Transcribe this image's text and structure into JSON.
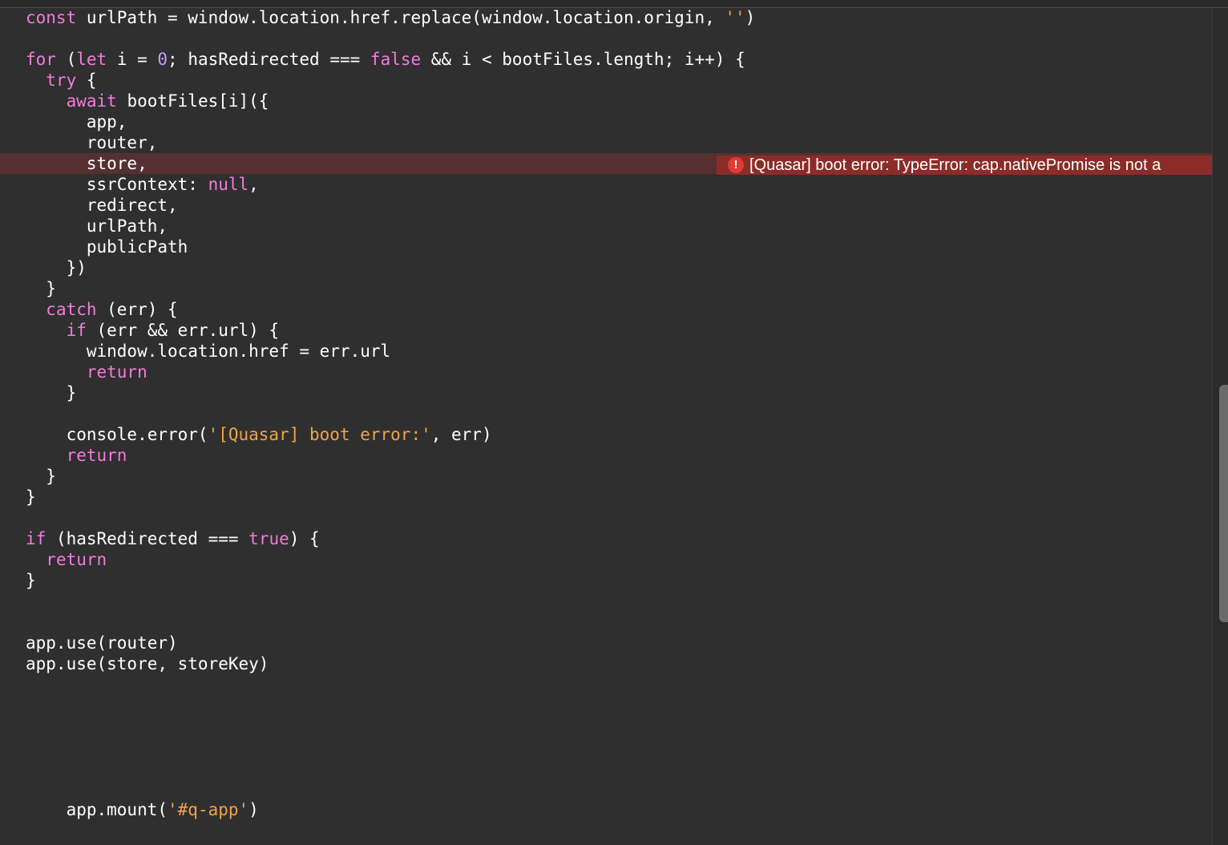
{
  "code_lines": [
    {
      "line": 1,
      "tokens": [
        {
          "t": "kw",
          "v": "const"
        },
        {
          "t": "plain",
          "v": " urlPath = window.location.href.replace(window.location.origin, "
        },
        {
          "t": "str",
          "v": "''"
        },
        {
          "t": "plain",
          "v": ")"
        }
      ]
    },
    {
      "line": 3,
      "tokens": [
        {
          "t": "kw",
          "v": "for"
        },
        {
          "t": "plain",
          "v": " ("
        },
        {
          "t": "kw",
          "v": "let"
        },
        {
          "t": "plain",
          "v": " i = "
        },
        {
          "t": "num",
          "v": "0"
        },
        {
          "t": "plain",
          "v": "; hasRedirected === "
        },
        {
          "t": "kw",
          "v": "false"
        },
        {
          "t": "plain",
          "v": " && i < bootFiles.length; i++) {"
        }
      ]
    },
    {
      "line": 4,
      "tokens": [
        {
          "t": "plain",
          "v": "  "
        },
        {
          "t": "kw",
          "v": "try"
        },
        {
          "t": "plain",
          "v": " {"
        }
      ]
    },
    {
      "line": 5,
      "tokens": [
        {
          "t": "plain",
          "v": "    "
        },
        {
          "t": "kw",
          "v": "await"
        },
        {
          "t": "plain",
          "v": " bootFiles[i]({"
        }
      ]
    },
    {
      "line": 6,
      "tokens": [
        {
          "t": "plain",
          "v": "      app,"
        }
      ]
    },
    {
      "line": 7,
      "tokens": [
        {
          "t": "plain",
          "v": "      router,"
        }
      ]
    },
    {
      "line": 8,
      "error": true,
      "tokens": [
        {
          "t": "plain",
          "v": "      store,"
        }
      ]
    },
    {
      "line": 9,
      "tokens": [
        {
          "t": "plain",
          "v": "      ssrContext: "
        },
        {
          "t": "kw",
          "v": "null"
        },
        {
          "t": "plain",
          "v": ","
        }
      ]
    },
    {
      "line": 10,
      "tokens": [
        {
          "t": "plain",
          "v": "      redirect,"
        }
      ]
    },
    {
      "line": 11,
      "tokens": [
        {
          "t": "plain",
          "v": "      urlPath,"
        }
      ]
    },
    {
      "line": 12,
      "tokens": [
        {
          "t": "plain",
          "v": "      publicPath"
        }
      ]
    },
    {
      "line": 13,
      "tokens": [
        {
          "t": "plain",
          "v": "    })"
        }
      ]
    },
    {
      "line": 14,
      "tokens": [
        {
          "t": "plain",
          "v": "  }"
        }
      ]
    },
    {
      "line": 15,
      "tokens": [
        {
          "t": "plain",
          "v": "  "
        },
        {
          "t": "kw",
          "v": "catch"
        },
        {
          "t": "plain",
          "v": " (err) {"
        }
      ]
    },
    {
      "line": 16,
      "tokens": [
        {
          "t": "plain",
          "v": "    "
        },
        {
          "t": "kw",
          "v": "if"
        },
        {
          "t": "plain",
          "v": " (err && err.url) {"
        }
      ]
    },
    {
      "line": 17,
      "tokens": [
        {
          "t": "plain",
          "v": "      window.location.href = err.url"
        }
      ]
    },
    {
      "line": 18,
      "tokens": [
        {
          "t": "plain",
          "v": "      "
        },
        {
          "t": "kw",
          "v": "return"
        }
      ]
    },
    {
      "line": 19,
      "tokens": [
        {
          "t": "plain",
          "v": "    }"
        }
      ]
    },
    {
      "line": 21,
      "tokens": [
        {
          "t": "plain",
          "v": "    console.error("
        },
        {
          "t": "str",
          "v": "'[Quasar] boot error:'"
        },
        {
          "t": "plain",
          "v": ", err)"
        }
      ]
    },
    {
      "line": 22,
      "tokens": [
        {
          "t": "plain",
          "v": "    "
        },
        {
          "t": "kw",
          "v": "return"
        }
      ]
    },
    {
      "line": 23,
      "tokens": [
        {
          "t": "plain",
          "v": "  }"
        }
      ]
    },
    {
      "line": 24,
      "tokens": [
        {
          "t": "plain",
          "v": "}"
        }
      ]
    },
    {
      "line": 26,
      "tokens": [
        {
          "t": "kw",
          "v": "if"
        },
        {
          "t": "plain",
          "v": " (hasRedirected === "
        },
        {
          "t": "kw",
          "v": "true"
        },
        {
          "t": "plain",
          "v": ") {"
        }
      ]
    },
    {
      "line": 27,
      "tokens": [
        {
          "t": "plain",
          "v": "  "
        },
        {
          "t": "kw",
          "v": "return"
        }
      ]
    },
    {
      "line": 28,
      "tokens": [
        {
          "t": "plain",
          "v": "}"
        }
      ]
    },
    {
      "line": 31,
      "tokens": [
        {
          "t": "plain",
          "v": "app.use(router)"
        }
      ]
    },
    {
      "line": 32,
      "tokens": [
        {
          "t": "plain",
          "v": "app.use(store, storeKey)"
        }
      ]
    },
    {
      "line": 39,
      "tokens": [
        {
          "t": "plain",
          "v": "    app.mount("
        },
        {
          "t": "str",
          "v": "'#q-app'"
        },
        {
          "t": "plain",
          "v": ")"
        }
      ]
    }
  ],
  "error_annotation": {
    "icon": "error-icon",
    "icon_glyph": "!",
    "message": "[Quasar] boot error: TypeError: cap.nativePromise is not a"
  },
  "colors": {
    "background": "#2f2f2f",
    "keyword": "#f27bdc",
    "number": "#c79cff",
    "string": "#f2a347",
    "error_line": "#563030",
    "error_badge": "#8c2c28"
  }
}
